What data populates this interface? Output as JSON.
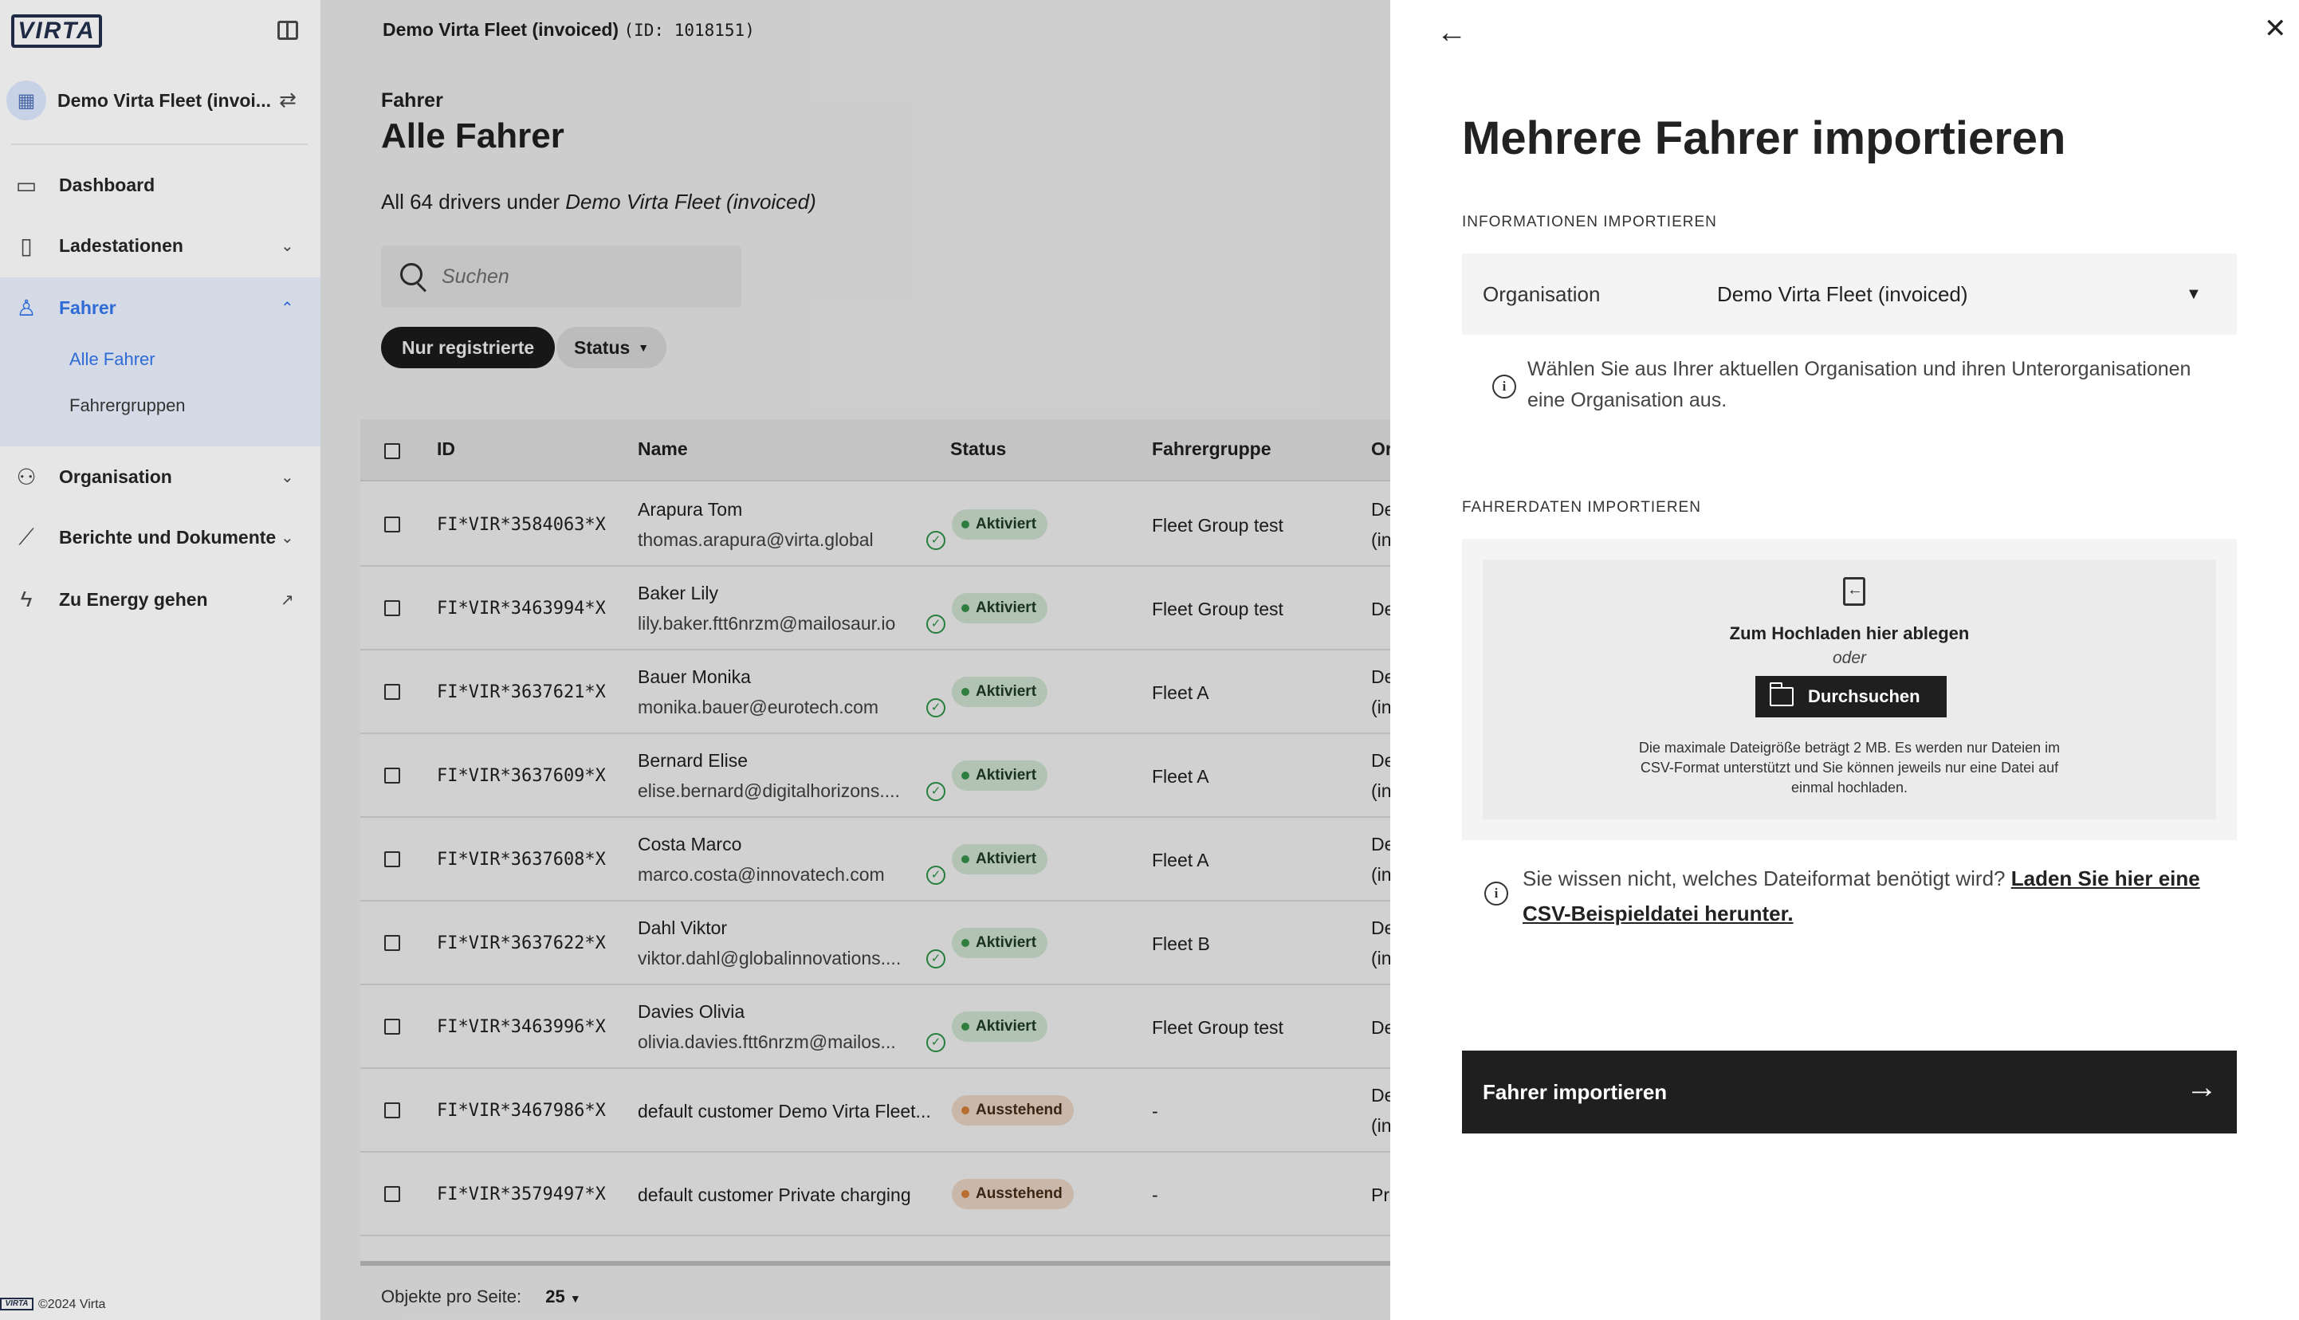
{
  "sidebar": {
    "logo": "VIRTA",
    "org_name": "Demo Virta Fleet (invoi...",
    "nav": [
      {
        "label": "Dashboard"
      },
      {
        "label": "Ladestationen"
      },
      {
        "label": "Fahrer"
      },
      {
        "label": "Organisation"
      },
      {
        "label": "Berichte und Dokumente"
      },
      {
        "label": "Zu Energy gehen"
      }
    ],
    "sub": [
      {
        "label": "Alle Fahrer"
      },
      {
        "label": "Fahrergruppen"
      }
    ],
    "footer_logo": "VIRTA",
    "footer_copy": "©2024 Virta"
  },
  "topbar": {
    "org": "Demo Virta Fleet (invoiced)",
    "id_text": "(ID: 1018151)"
  },
  "page": {
    "kicker": "Fahrer",
    "title": "Alle Fahrer",
    "sub_prefix": "All 64 drivers under",
    "sub_org": "Demo Virta Fleet (invoiced)",
    "search_placeholder": "Suchen",
    "filter_registered": "Nur registrierte",
    "filter_status": "Status"
  },
  "table": {
    "headers": [
      "ID",
      "Name",
      "Status",
      "Fahrergruppe",
      "Or"
    ],
    "rows": [
      {
        "id": "FI*VIR*3584063*X",
        "name": "Arapura Tom",
        "email": "thomas.arapura@virta.global",
        "verified": true,
        "status": "Aktiviert",
        "status_kind": "ok",
        "group": "Fleet Group test",
        "org1": "De",
        "org2": "(in"
      },
      {
        "id": "FI*VIR*3463994*X",
        "name": "Baker Lily",
        "email": "lily.baker.ftt6nrzm@mailosaur.io",
        "verified": true,
        "status": "Aktiviert",
        "status_kind": "ok",
        "group": "Fleet Group test",
        "org1": "De",
        "org2": ""
      },
      {
        "id": "FI*VIR*3637621*X",
        "name": "Bauer Monika",
        "email": "monika.bauer@eurotech.com",
        "verified": true,
        "status": "Aktiviert",
        "status_kind": "ok",
        "group": "Fleet A",
        "org1": "De",
        "org2": "(in"
      },
      {
        "id": "FI*VIR*3637609*X",
        "name": "Bernard Elise",
        "email": "elise.bernard@digitalhorizons....",
        "verified": true,
        "status": "Aktiviert",
        "status_kind": "ok",
        "group": "Fleet A",
        "org1": "De",
        "org2": "(in"
      },
      {
        "id": "FI*VIR*3637608*X",
        "name": "Costa Marco",
        "email": "marco.costa@innovatech.com",
        "verified": true,
        "status": "Aktiviert",
        "status_kind": "ok",
        "group": "Fleet A",
        "org1": "De",
        "org2": "(in"
      },
      {
        "id": "FI*VIR*3637622*X",
        "name": "Dahl Viktor",
        "email": "viktor.dahl@globalinnovations....",
        "verified": true,
        "status": "Aktiviert",
        "status_kind": "ok",
        "group": "Fleet B",
        "org1": "De",
        "org2": "(in"
      },
      {
        "id": "FI*VIR*3463996*X",
        "name": "Davies Olivia",
        "email": "olivia.davies.ftt6nrzm@mailos...",
        "verified": true,
        "status": "Aktiviert",
        "status_kind": "ok",
        "group": "Fleet Group test",
        "org1": "De",
        "org2": ""
      },
      {
        "id": "FI*VIR*3467986*X",
        "name": "default customer Demo Virta Fleet...",
        "email": "",
        "verified": false,
        "status": "Ausstehend",
        "status_kind": "pending",
        "group": "-",
        "org1": "De",
        "org2": "(in"
      },
      {
        "id": "FI*VIR*3579497*X",
        "name": "default customer Private charging",
        "email": "",
        "verified": false,
        "status": "Ausstehend",
        "status_kind": "pending",
        "group": "-",
        "org1": "Pri",
        "org2": ""
      }
    ],
    "per_page_label": "Objekte pro Seite:",
    "per_page_value": "25"
  },
  "drawer": {
    "title": "Mehrere Fahrer importieren",
    "section_info": "INFORMATIONEN IMPORTIEREN",
    "org_label": "Organisation",
    "org_value": "Demo Virta Fleet (invoiced)",
    "org_info": "Wählen Sie aus Ihrer aktuellen Organisation und ihren Unterorganisationen eine Organisation aus.",
    "section_data": "FAHRERDATEN IMPORTIEREN",
    "drop_text": "Zum Hochladen hier ablegen",
    "or_text": "oder",
    "browse_label": "Durchsuchen",
    "upload_hint": "Die maximale Dateigröße beträgt 2 MB. Es werden nur Dateien im CSV-Format unterstützt und Sie können jeweils nur eine Datei auf einmal hochladen.",
    "csv_question": "Sie wissen nicht, welches Dateiformat benötigt wird?",
    "csv_link": "Laden Sie hier eine CSV-Beispieldatei herunter.",
    "import_button": "Fahrer importieren"
  },
  "colors": {
    "accent": "#2f6bd6",
    "active_nav_bg": "#d4dbe6",
    "dark_button": "#1f1f1f",
    "ok_badge": "#d9eedc",
    "pending_badge": "#f6e1cf"
  }
}
